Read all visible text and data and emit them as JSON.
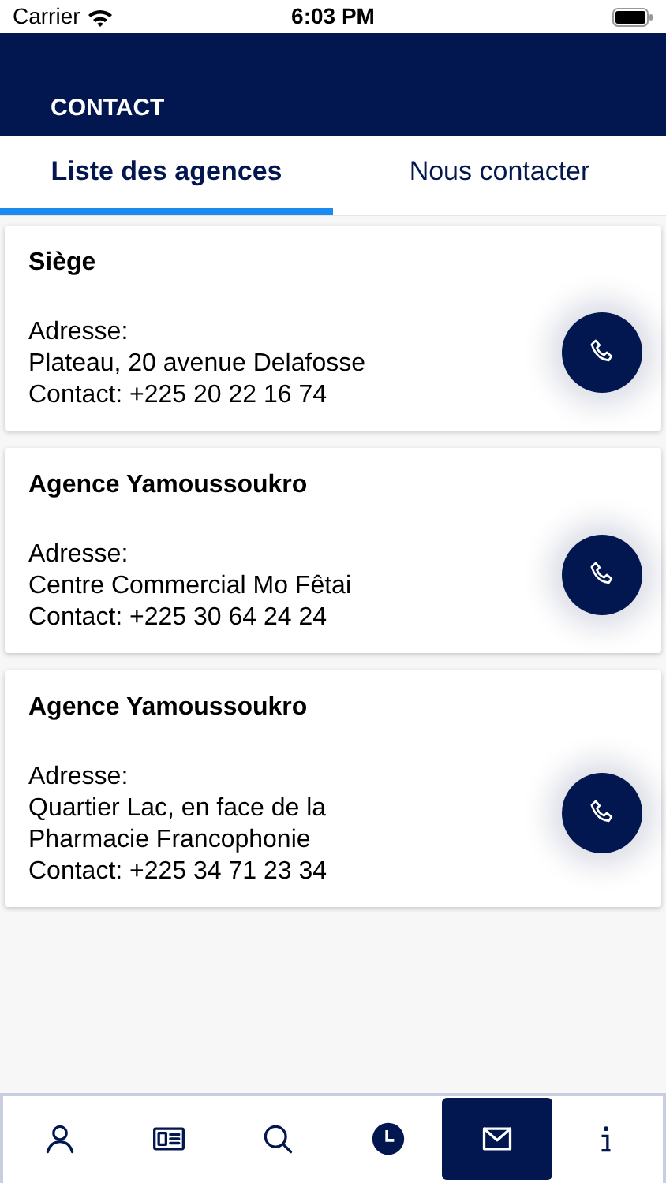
{
  "status_bar": {
    "carrier": "Carrier",
    "time": "6:03 PM"
  },
  "header": {
    "title": "CONTACT"
  },
  "tabs": [
    {
      "label": "Liste des agences",
      "selected": true
    },
    {
      "label": "Nous contacter",
      "selected": false
    }
  ],
  "agencies": [
    {
      "name": "Siège",
      "address_label": "Adresse:",
      "address": [
        "Plateau, 20 avenue Delafosse"
      ],
      "contact": "Contact: +225  20 22 16 74"
    },
    {
      "name": "Agence Yamoussoukro",
      "address_label": "Adresse:",
      "address": [
        "Centre Commercial Mo Fêtai"
      ],
      "contact": "Contact: +225  30 64 24 24"
    },
    {
      "name": "Agence Yamoussoukro",
      "address_label": "Adresse:",
      "address": [
        "Quartier Lac, en face de la",
        "Pharmacie Francophonie"
      ],
      "contact": "Contact: +225 34 71 23 34"
    }
  ],
  "bottom_nav": [
    {
      "kind": "person",
      "selected": false
    },
    {
      "kind": "id-card",
      "selected": false
    },
    {
      "kind": "search",
      "selected": false
    },
    {
      "kind": "clock",
      "selected": false
    },
    {
      "kind": "mail",
      "selected": true
    },
    {
      "kind": "info",
      "selected": false
    }
  ]
}
